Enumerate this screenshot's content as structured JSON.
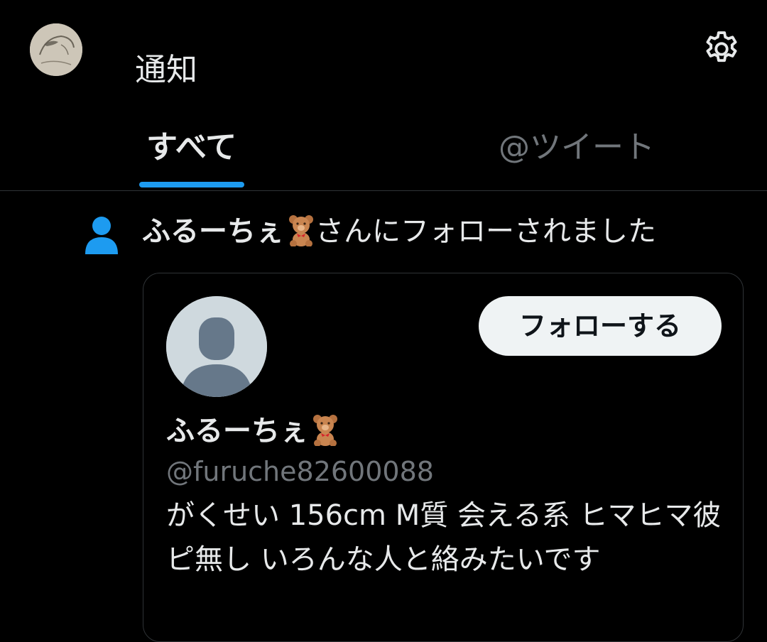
{
  "header": {
    "title": "通知"
  },
  "tabs": [
    {
      "label": "すべて",
      "active": true
    },
    {
      "label": "@ツイート",
      "active": false
    }
  ],
  "notification": {
    "user_name": "ふるーちぇ",
    "emoji": "teddy-bear",
    "message": "さんにフォローされました"
  },
  "card": {
    "display_name": "ふるーちぇ",
    "handle": "@furuche82600088",
    "bio": "がくせい 156cm M質 会える系 ヒマヒマ彼ピ無し いろんな人と絡みたいです",
    "follow_button_label": "フォローする"
  },
  "colors": {
    "background": "#000000",
    "accent": "#1d9bf0",
    "primary_text": "#e7e9ea",
    "secondary_text": "#71767b",
    "border": "#2f3336",
    "button_bg": "#eff3f4"
  },
  "icons": [
    "user-avatar",
    "gear-icon",
    "person-icon",
    "teddy-bear-emoji",
    "default-avatar"
  ]
}
